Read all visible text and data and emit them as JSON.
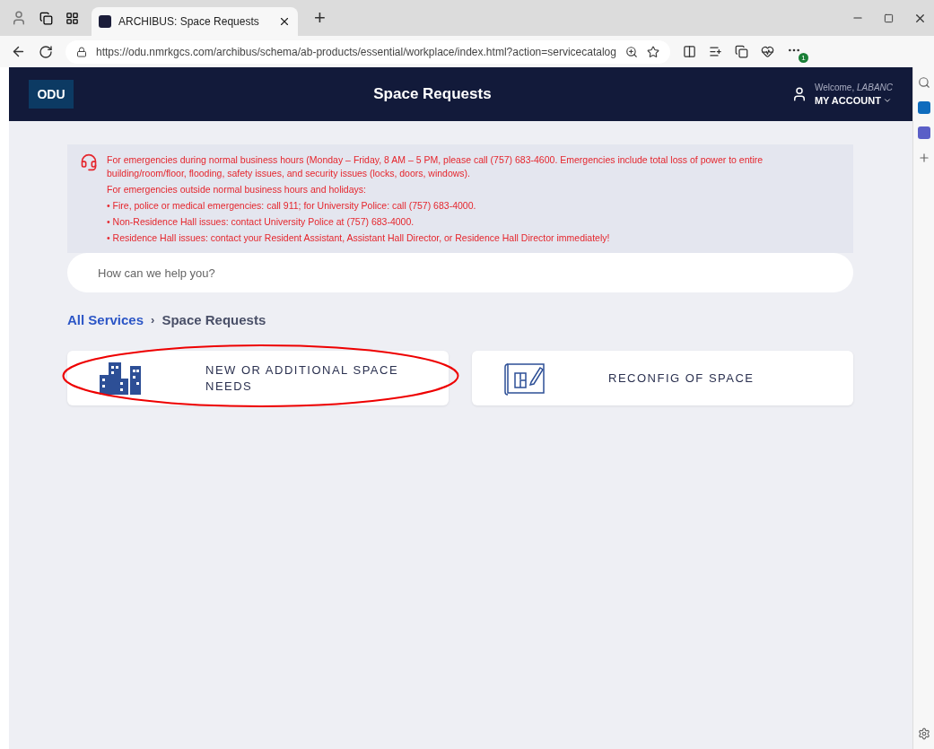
{
  "browser": {
    "tab_title": "ARCHIBUS: Space Requests",
    "new_tab": "+",
    "url": "https://odu.nmrkgcs.com/archibus/schema/ab-products/essential/workplace/index.html?action=servicecatalog",
    "extension_badge": "1"
  },
  "header": {
    "logo": "ODU",
    "title": "Space Requests",
    "welcome": "Welcome, *LABANC*",
    "account": "MY ACCOUNT"
  },
  "notice": {
    "lines": [
      "For emergencies during normal business hours (Monday – Friday, 8 AM – 5 PM, please call (757) 683-4600. Emergencies include total loss of power to entire building/room/floor, flooding, safety issues, and security issues (locks, doors, windows).",
      "For emergencies outside normal business hours and holidays:",
      "• Fire, police or medical emergencies: call 911; for University Police: call (757) 683-4000.",
      "• Non-Residence Hall issues: contact University Police at (757) 683-4000.",
      "• Residence Hall issues: contact your Resident Assistant, Assistant Hall Director, or Residence Hall Director immediately!"
    ]
  },
  "search": {
    "placeholder": "How can we help you?"
  },
  "breadcrumb": {
    "separator": "›",
    "items": [
      {
        "label": "All Services",
        "kind": "link"
      },
      {
        "label": "Space Requests",
        "kind": "current"
      }
    ]
  },
  "services": [
    {
      "label": "NEW OR ADDITIONAL SPACE NEEDS",
      "kind": "buildings",
      "circled": true
    },
    {
      "label": "RECONFIG OF SPACE",
      "kind": "blueprint",
      "circled": false
    }
  ]
}
